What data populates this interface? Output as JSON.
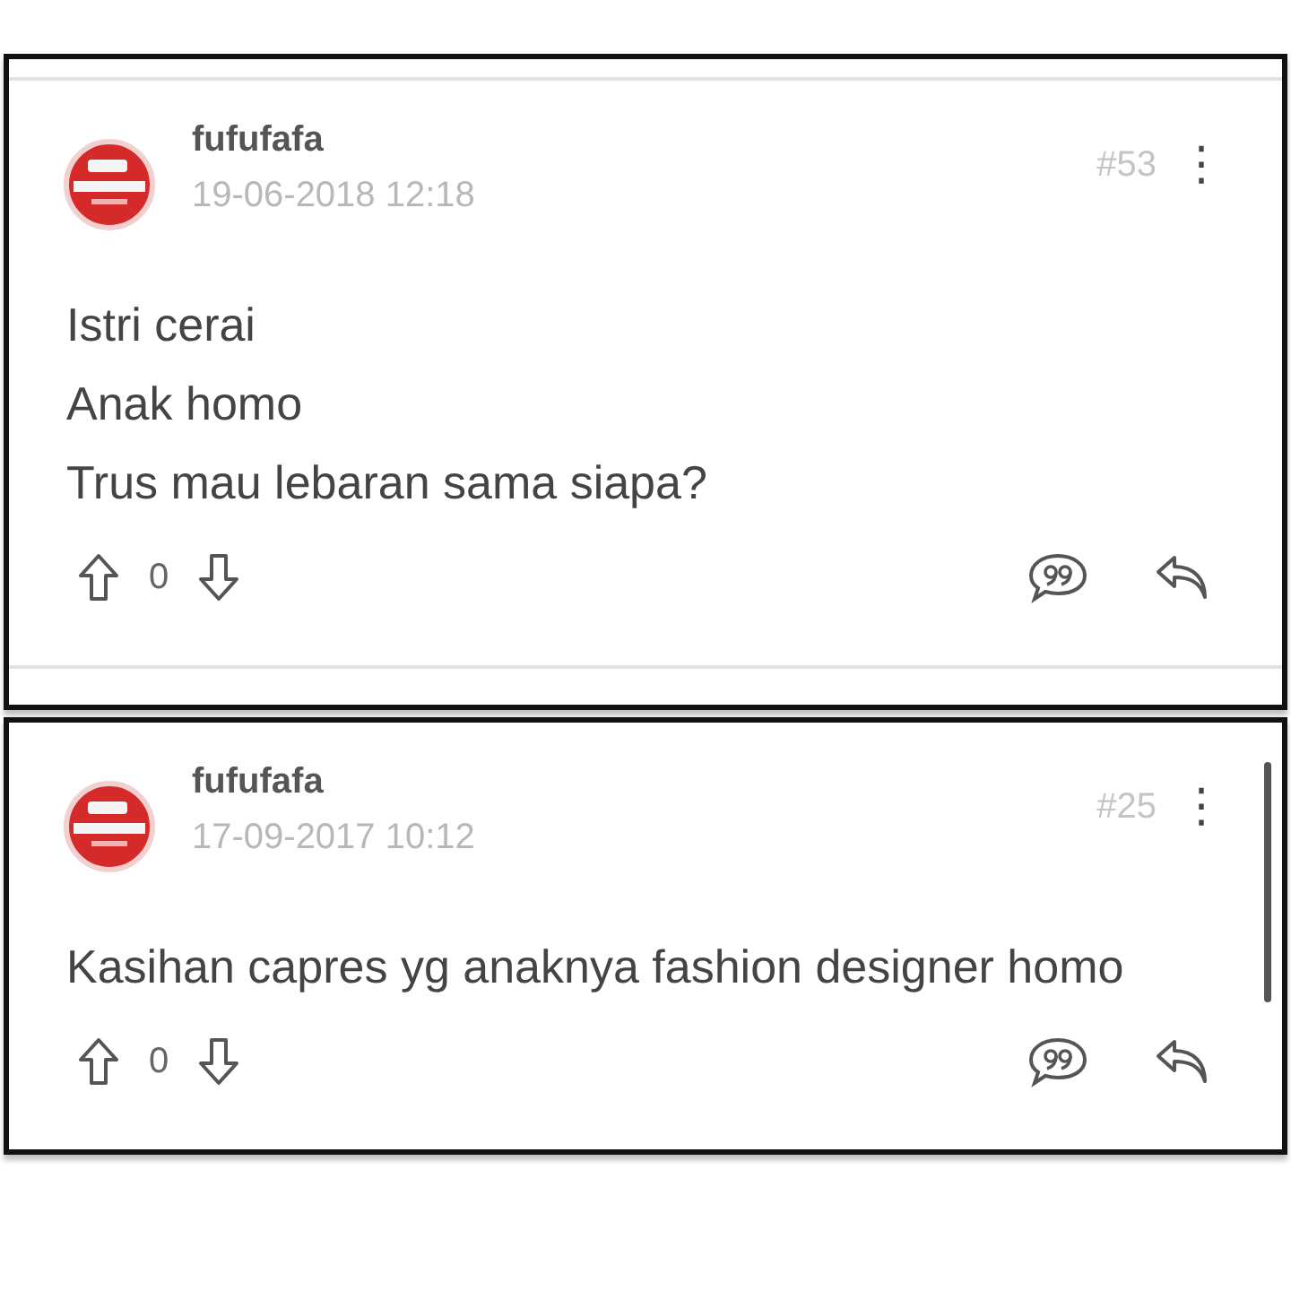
{
  "posts": [
    {
      "username": "fufufafa",
      "date": "19-06-2018 12:18",
      "number": "#53",
      "menu": "⋮",
      "body": "Istri cerai\nAnak homo\nTrus mau lebaran sama siapa?",
      "votes": "0",
      "top_rule": true,
      "bottom_rule": true,
      "scrollbar": false
    },
    {
      "username": "fufufafa",
      "date": "17-09-2017 10:12",
      "number": "#25",
      "menu": "⋮",
      "body": "Kasihan capres yg anaknya fashion designer homo",
      "votes": "0",
      "top_rule": false,
      "bottom_rule": false,
      "scrollbar": true
    }
  ]
}
